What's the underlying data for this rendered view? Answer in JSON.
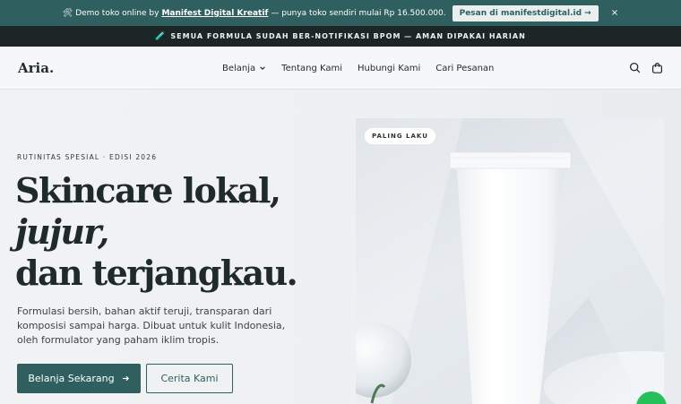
{
  "promo": {
    "icon": "tools-icon",
    "prefix": "🛠 Demo toko online by",
    "brand": "Manifest Digital Kreatif",
    "suffix": "— punya toko sendiri mulai Rp 16.500.000.",
    "cta": "Pesan di manifestdigital.id →",
    "close": "×"
  },
  "notice": {
    "icon": "🧪",
    "text": "SEMUA FORMULA SUDAH BER-NOTIFIKASI BPOM — AMAN DIPAKAI HARIAN"
  },
  "header": {
    "logo": "Aria.",
    "nav": [
      "Belanja",
      "Tentang Kami",
      "Hubungi Kami",
      "Cari Pesanan"
    ]
  },
  "hero": {
    "eyebrow": "RUTINITAS SPESIAL · EDISI 2026",
    "title_line1": "Skincare lokal,",
    "title_line2": "jujur,",
    "title_line3": "dan terjangkau.",
    "description": "Formulasi bersih, bahan aktif teruji, transparan dari komposisi sampai harga. Dibuat untuk kulit Indonesia, oleh formulator yang paham iklim tropis.",
    "primary_button": "Belanja Sekarang",
    "secondary_button": "Cerita Kami",
    "badge": "PALING LAKU"
  },
  "colors": {
    "accent": "#2f5f5f",
    "dark": "#1d2626",
    "whatsapp": "#25c05a"
  }
}
